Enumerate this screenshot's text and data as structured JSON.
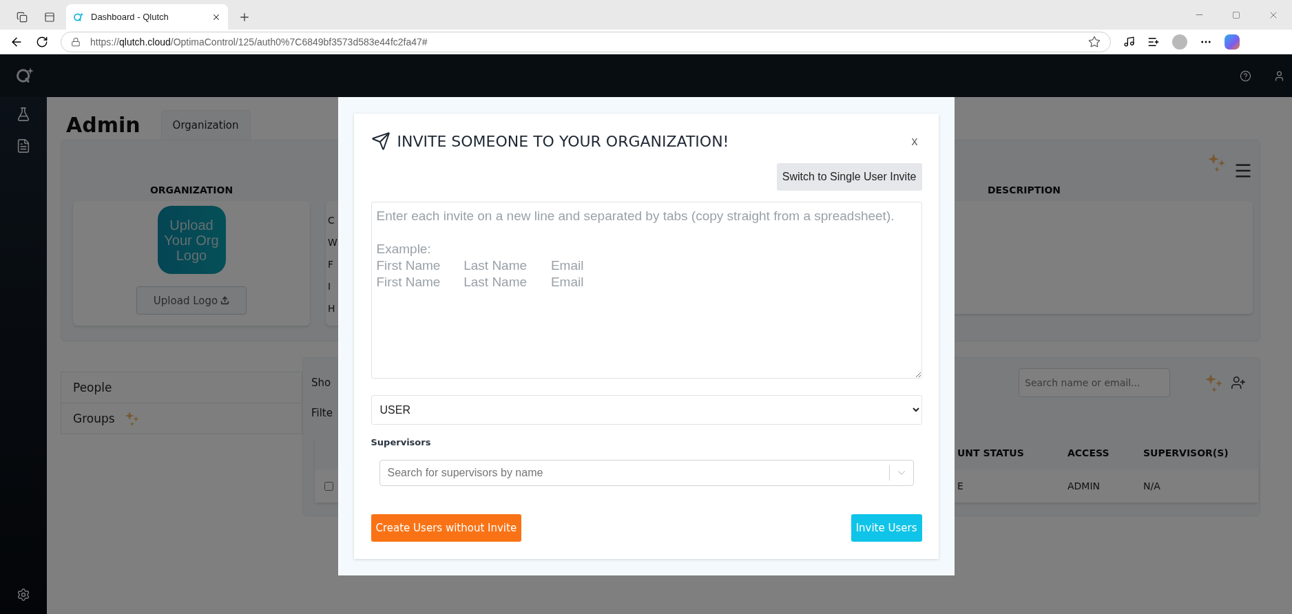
{
  "browser": {
    "tab_title": "Dashboard - Qlutch",
    "url_scheme": "https://",
    "url_host": "qlutch.cloud",
    "url_path": "/OptimaControl/125/auth0%7C6849bf3573d583e44fc2fa47#"
  },
  "page": {
    "title": "Admin",
    "tabs": [
      {
        "label": "Organization",
        "selected": true
      }
    ]
  },
  "organization": {
    "heading": "ORGANIZATION",
    "logo_placeholder": "Upload Your Org Logo",
    "upload_button": "Upload Logo"
  },
  "details_labels": [
    "C",
    "W",
    "F",
    "I",
    "H"
  ],
  "description": {
    "heading": "DESCRIPTION"
  },
  "side_list": [
    {
      "label": "People",
      "sparkle": false
    },
    {
      "label": "Groups",
      "sparkle": true
    }
  ],
  "people": {
    "show_label": "Sho",
    "filter_label": "Filte",
    "search": {
      "placeholder": "Search name or email..."
    },
    "table": {
      "columns": [
        "UNT STATUS",
        "ACCESS",
        "SUPERVISOR(S)"
      ],
      "rows": [
        {
          "checked": false,
          "cells": [
            "E",
            "ADMIN",
            "N/A"
          ]
        }
      ]
    }
  },
  "modal": {
    "title": "INVITE SOMEONE TO YOUR ORGANIZATION!",
    "close_label": "x",
    "switch_button": "Switch to Single User Invite",
    "invite_placeholder": "Enter each invite on a new line and separated by tabs (copy straight from a spreadsheet).\n\nExample:\nFirst Name\tLast Name\tEmail\nFirst Name\tLast Name\tEmail",
    "role": "USER",
    "supervisors_label": "Supervisors",
    "supervisors_placeholder": "Search for supervisors by name",
    "create_button": "Create Users without Invite",
    "invite_button": "Invite Users"
  }
}
